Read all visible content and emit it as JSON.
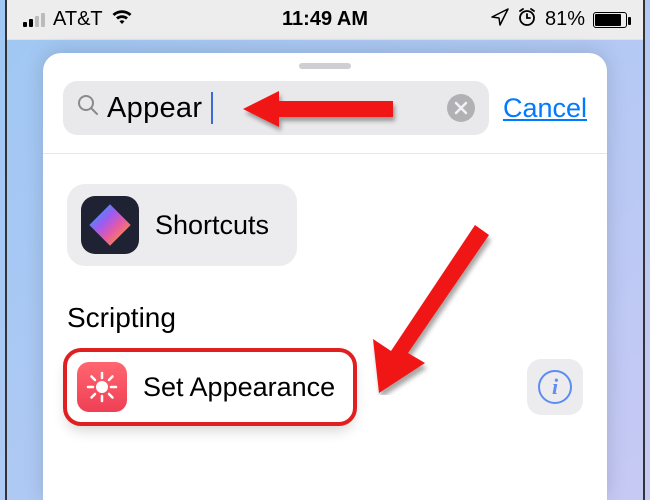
{
  "status_bar": {
    "carrier": "AT&T",
    "time": "11:49 AM",
    "battery_percent": "81%",
    "signal_active_bars": 2,
    "signal_total_bars": 4
  },
  "search": {
    "value": "Appear",
    "cancel_label": "Cancel"
  },
  "app_card": {
    "label": "Shortcuts"
  },
  "section": {
    "header": "Scripting"
  },
  "action": {
    "label": "Set Appearance"
  },
  "annotation": {
    "arrow_color": "#f11515"
  }
}
